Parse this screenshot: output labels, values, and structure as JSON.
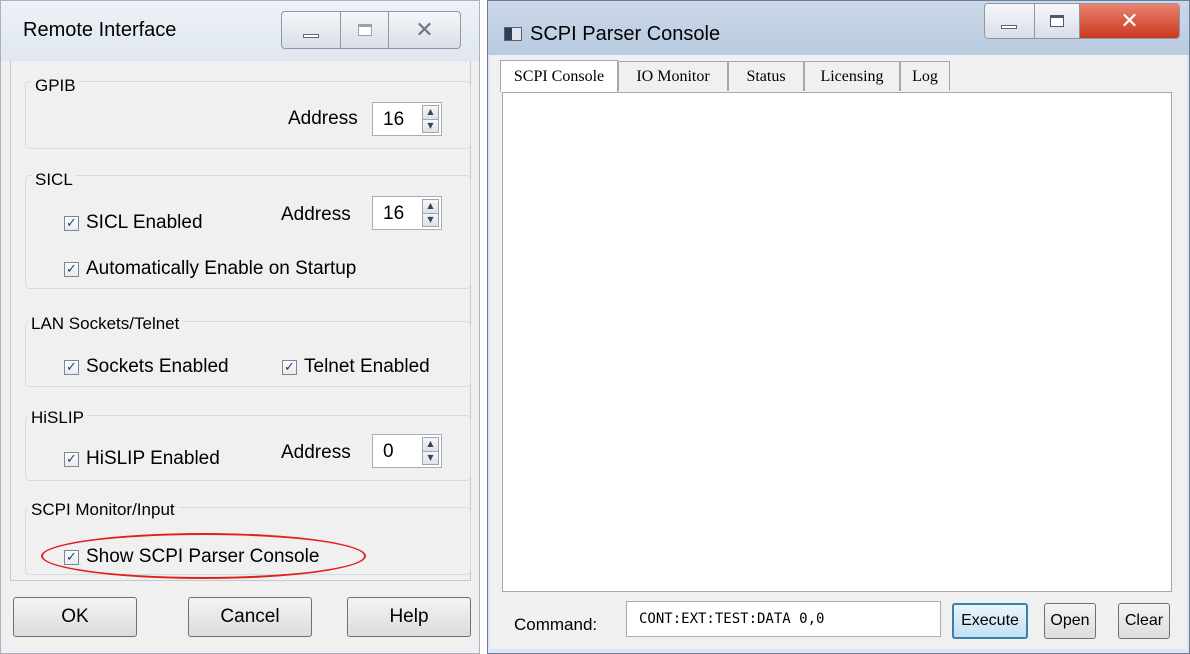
{
  "remote_window": {
    "title": "Remote Interface",
    "gpib": {
      "label": "GPIB",
      "address_label": "Address",
      "address_value": "16"
    },
    "sicl": {
      "label": "SICL",
      "enabled_label": "SICL Enabled",
      "enabled": true,
      "address_label": "Address",
      "address_value": "16",
      "auto_enable_label": "Automatically Enable on Startup",
      "auto_enable": true
    },
    "lan": {
      "label": "LAN Sockets/Telnet",
      "sockets_label": "Sockets Enabled",
      "sockets": true,
      "telnet_label": "Telnet Enabled",
      "telnet": true
    },
    "hislip": {
      "label": "HiSLIP",
      "enabled_label": "HiSLIP Enabled",
      "enabled": true,
      "address_label": "Address",
      "address_value": "0"
    },
    "scpi_monitor": {
      "label": "SCPI Monitor/Input",
      "show_console_label": "Show SCPI Parser Console",
      "show_console": true
    },
    "buttons": {
      "ok": "OK",
      "cancel": "Cancel",
      "help": "Help"
    },
    "highlight_color": "#e0201a"
  },
  "scpi_window": {
    "title": "SCPI Parser Console",
    "tabs": [
      {
        "label": "SCPI Console",
        "active": true
      },
      {
        "label": "IO Monitor",
        "active": false
      },
      {
        "label": "Status",
        "active": false
      },
      {
        "label": "Licensing",
        "active": false
      },
      {
        "label": "Log",
        "active": false
      }
    ],
    "command_label": "Command:",
    "command_value": "CONT:EXT:TEST:DATA 0,0",
    "buttons": {
      "execute": "Execute",
      "open": "Open",
      "clear": "Clear"
    }
  },
  "check_glyph": "✓",
  "icons": {
    "minimize": "minimize-icon",
    "maximize": "maximize-icon",
    "close": "close-icon",
    "spin_up": "▲",
    "spin_down": "▼"
  }
}
